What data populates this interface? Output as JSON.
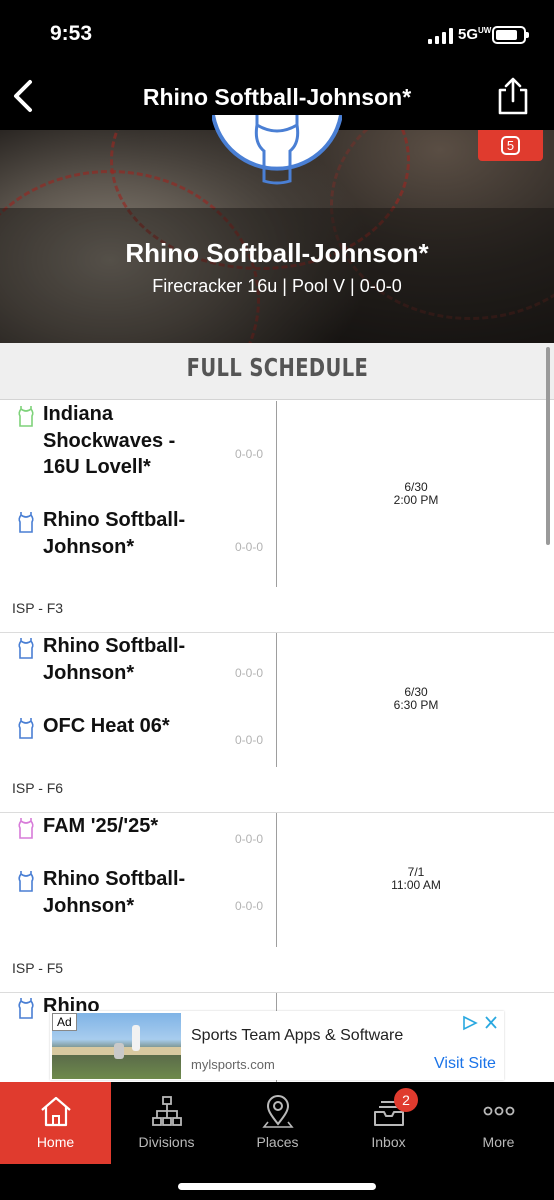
{
  "status": {
    "time": "9:53",
    "network": "5G",
    "network_sub": "UW"
  },
  "nav": {
    "title": "Rhino Softball-Johnson*"
  },
  "hero": {
    "team_name": "Rhino Softball-Johnson*",
    "subtitle": "Firecracker 16u | Pool V | 0-0-0",
    "badge_count": "5"
  },
  "schedule": {
    "header": "FULL SCHEDULE",
    "games": [
      {
        "home": {
          "name": "Indiana Shockwaves - 16U Lovell*",
          "record": "0-0-0",
          "jersey_color": "#7ed27a"
        },
        "away": {
          "name": "Rhino Softball-Johnson*",
          "record": "0-0-0",
          "jersey_color": "#4a7fd4"
        },
        "date": "6/30",
        "time": "2:00 PM",
        "location": "ISP - F3"
      },
      {
        "home": {
          "name": "Rhino Softball-Johnson*",
          "record": "0-0-0",
          "jersey_color": "#4a7fd4"
        },
        "away": {
          "name": "OFC Heat 06*",
          "record": "0-0-0",
          "jersey_color": "#4a7fd4"
        },
        "date": "6/30",
        "time": "6:30 PM",
        "location": "ISP - F6"
      },
      {
        "home": {
          "name": "FAM '25/'25*",
          "record": "0-0-0",
          "jersey_color": "#d77bd9"
        },
        "away": {
          "name": "Rhino Softball-Johnson*",
          "record": "0-0-0",
          "jersey_color": "#4a7fd4"
        },
        "date": "7/1",
        "time": "11:00 AM",
        "location": "ISP - F5"
      },
      {
        "home": {
          "name": "Rhino",
          "jersey_color": "#4a7fd4"
        }
      }
    ]
  },
  "ad": {
    "label": "Ad",
    "title": "Sports Team Apps & Software",
    "url": "mylsports.com",
    "cta": "Visit Site"
  },
  "tabs": [
    {
      "label": "Home",
      "icon": "home-icon",
      "active": true
    },
    {
      "label": "Divisions",
      "icon": "bracket-icon",
      "active": false
    },
    {
      "label": "Places",
      "icon": "location-pin-icon",
      "active": false
    },
    {
      "label": "Inbox",
      "icon": "inbox-icon",
      "active": false,
      "badge": "2"
    },
    {
      "label": "More",
      "icon": "more-dots-icon",
      "active": false
    }
  ],
  "colors": {
    "accent": "#e03b2e",
    "bar": "#000000",
    "link": "#1a73e8"
  }
}
